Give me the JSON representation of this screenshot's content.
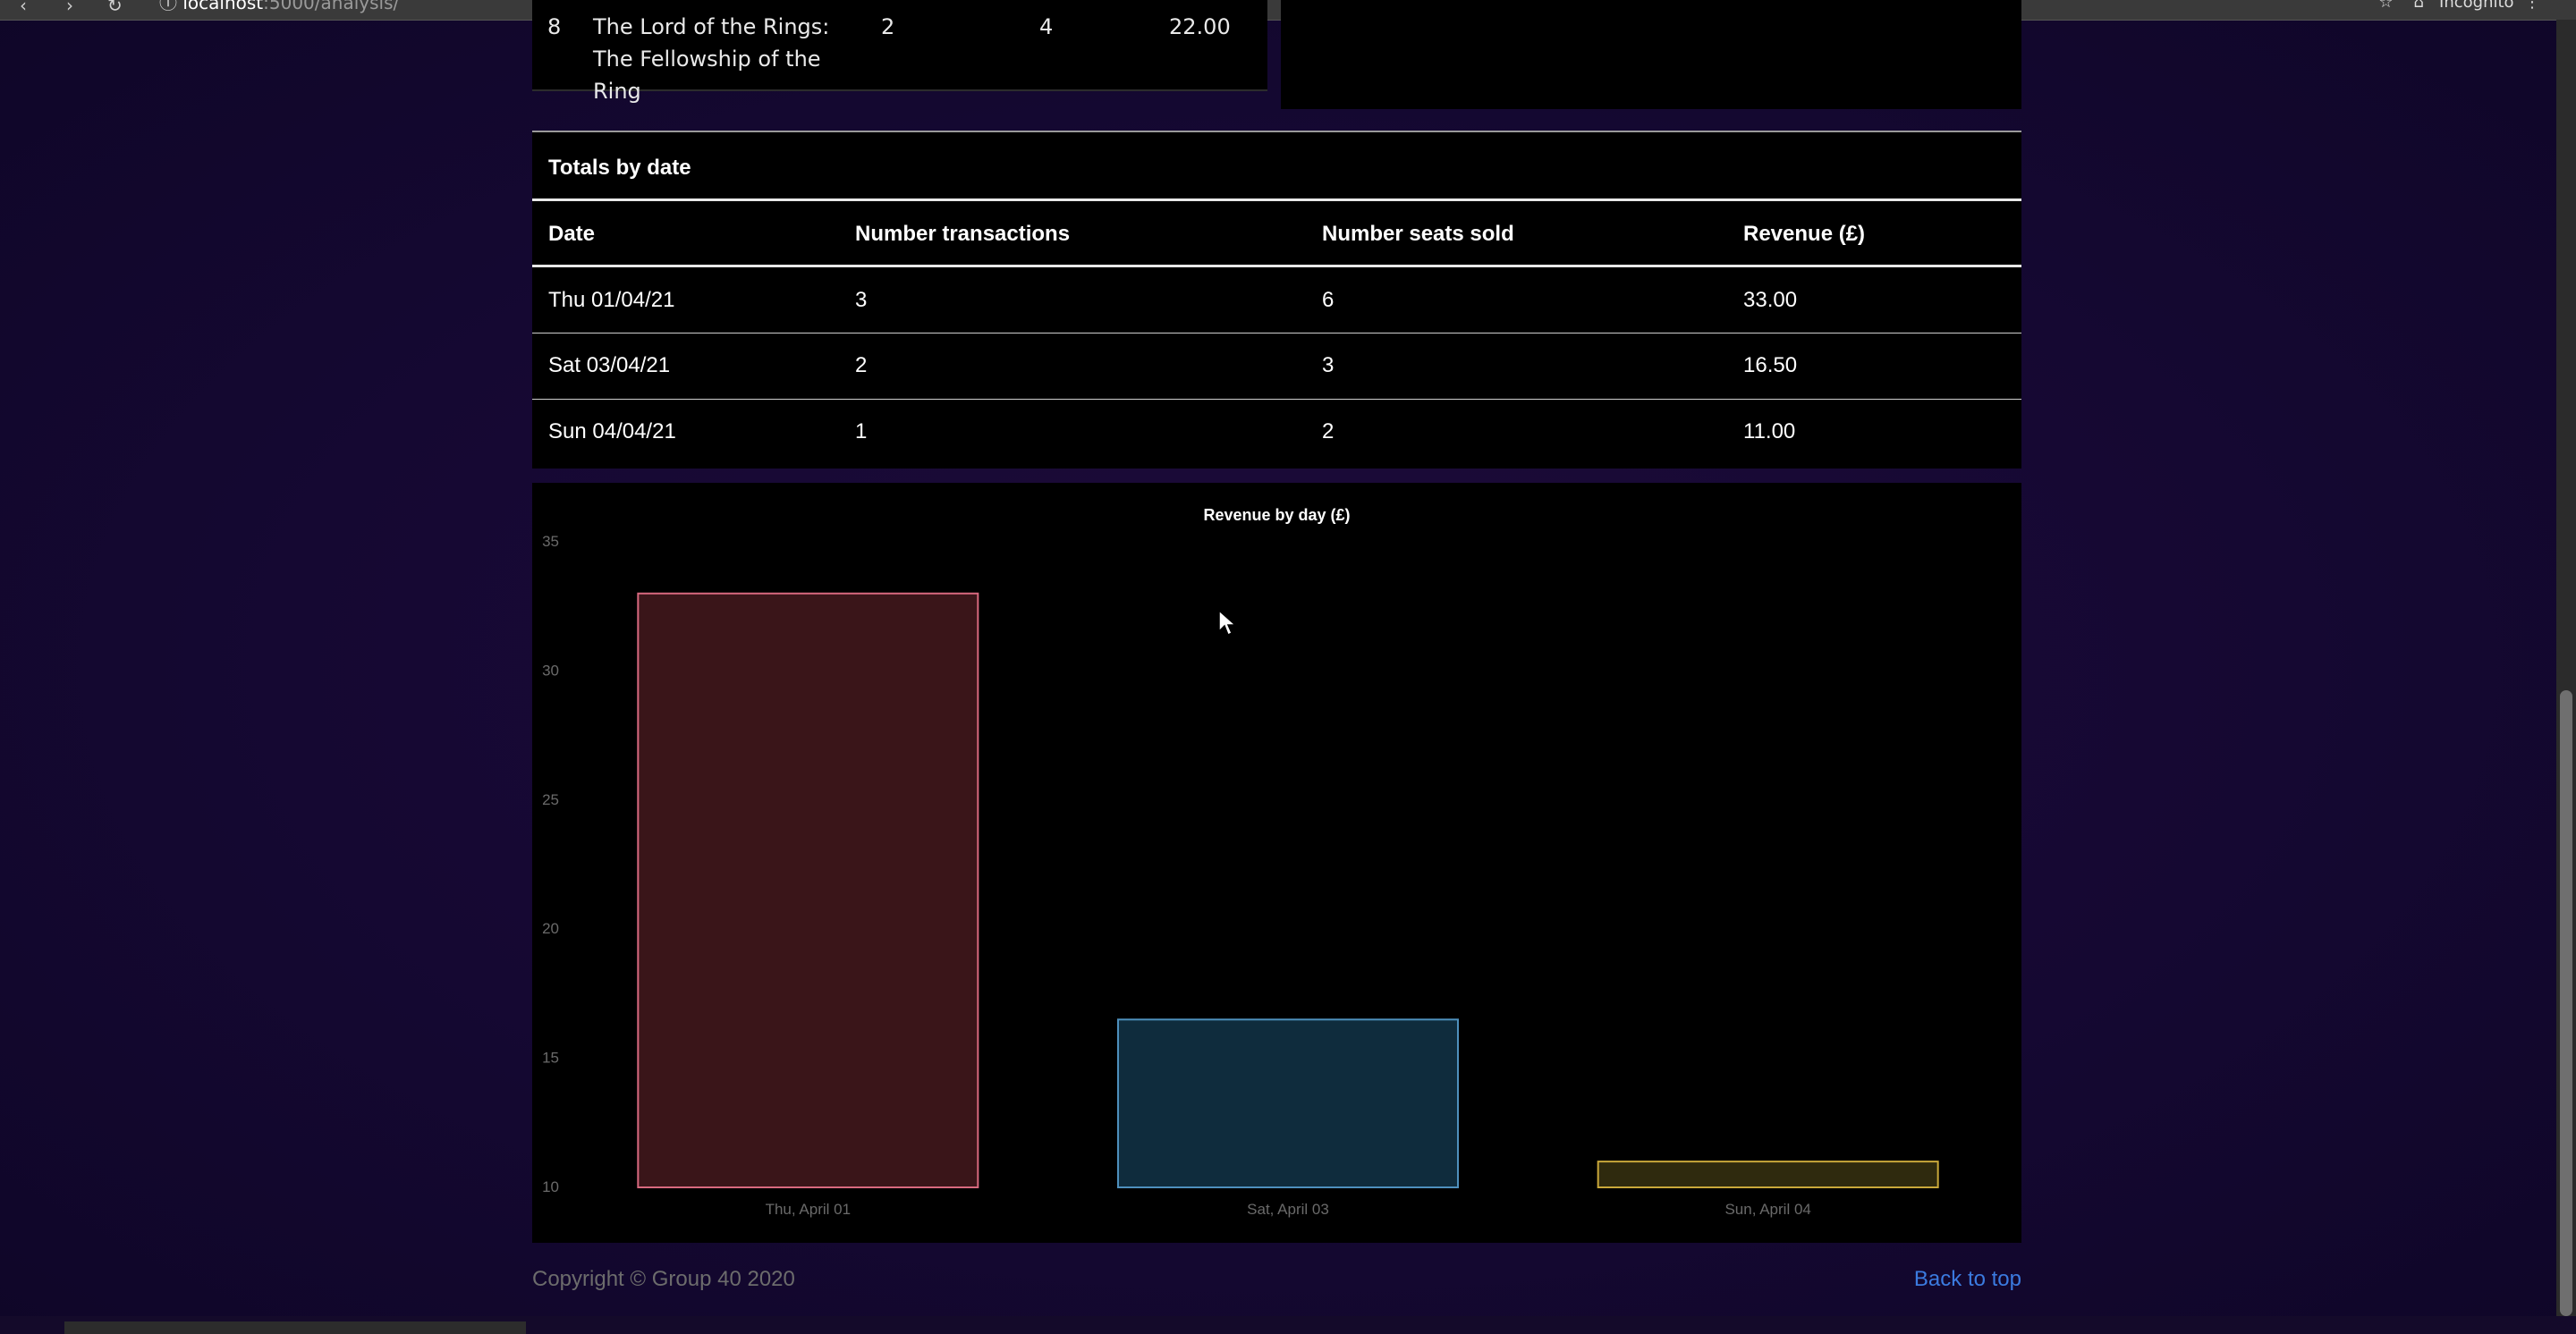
{
  "browser": {
    "url_host": "localhost",
    "url_path": ":5000/analysis/",
    "profile_label": "Incognito"
  },
  "film_row": {
    "rank": "8",
    "title": "The Lord of the Rings: The Fellowship of the Ring",
    "transactions": "2",
    "seats": "4",
    "revenue": "22.00"
  },
  "totals": {
    "caption": "Totals by date",
    "headers": [
      "Date",
      "Number transactions",
      "Number seats sold",
      "Revenue (£)"
    ],
    "rows": [
      [
        "Thu 01/04/21",
        "3",
        "6",
        "33.00"
      ],
      [
        "Sat 03/04/21",
        "2",
        "3",
        "16.50"
      ],
      [
        "Sun 04/04/21",
        "1",
        "2",
        "11.00"
      ]
    ]
  },
  "chart_data": {
    "type": "bar",
    "title": "Revenue by day (£)",
    "categories": [
      "Thu, April 01",
      "Sat, April 03",
      "Sun, April 04"
    ],
    "values": [
      33.0,
      16.5,
      11.0
    ],
    "ylim": [
      10,
      35
    ],
    "yticks": [
      "35",
      "30",
      "25",
      "20",
      "15",
      "10"
    ],
    "grid": false,
    "colors": {
      "fill": [
        "#3a1519",
        "#0f2c3d",
        "#2f2a0e"
      ],
      "border": [
        "#d8697f",
        "#4e90bd",
        "#c9a83a"
      ]
    }
  },
  "footer": {
    "copyright": "Copyright © Group 40 2020",
    "back_to_top": "Back to top"
  }
}
